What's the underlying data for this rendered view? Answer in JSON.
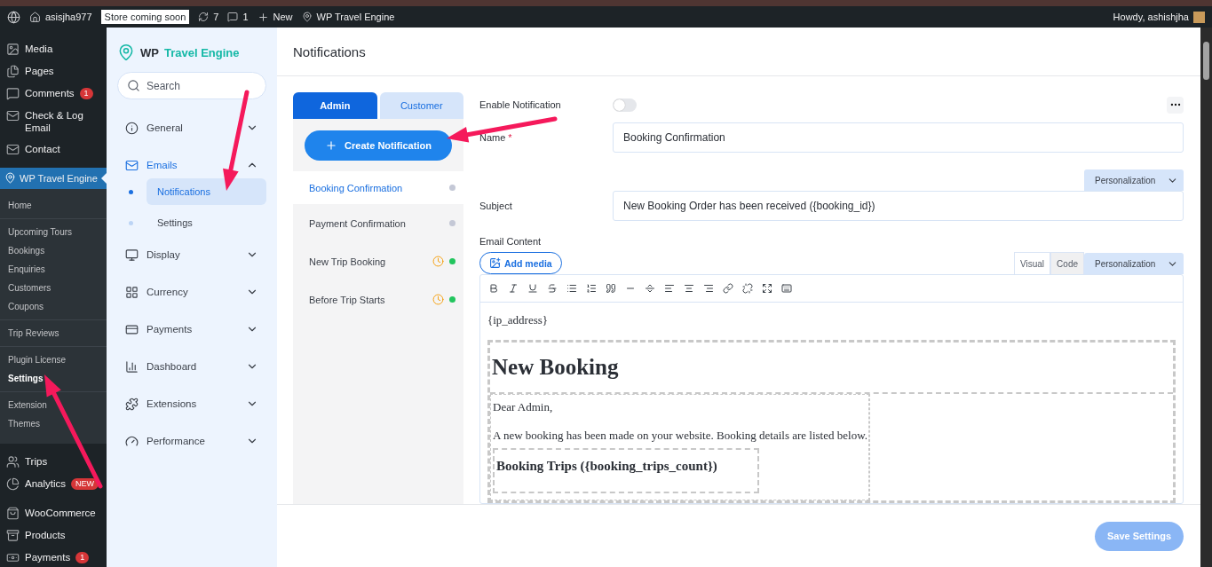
{
  "admin_bar": {
    "site": "asisjha977",
    "store_badge": "Store coming soon",
    "updates": "7",
    "comments": "1",
    "new": "New",
    "plugin": "WP Travel Engine",
    "greeting": "Howdy, ashishjha"
  },
  "wp_menu": {
    "top": [
      {
        "label": "Media"
      },
      {
        "label": "Pages"
      },
      {
        "label": "Comments",
        "badge": "1"
      },
      {
        "label": "Check & Log Email"
      },
      {
        "label": "Contact"
      }
    ],
    "active": {
      "label": "WP Travel Engine"
    },
    "submenu": [
      [
        {
          "label": "Home",
          "selected": false
        }
      ],
      [
        {
          "label": "Upcoming Tours",
          "selected": false
        },
        {
          "label": "Bookings",
          "selected": false
        },
        {
          "label": "Enquiries",
          "selected": false
        },
        {
          "label": "Customers",
          "selected": false
        },
        {
          "label": "Coupons",
          "selected": false
        }
      ],
      [
        {
          "label": "Trip Reviews",
          "selected": false
        }
      ],
      [
        {
          "label": "Plugin License",
          "selected": false
        },
        {
          "label": "Settings",
          "selected": true
        }
      ],
      [
        {
          "label": "Extension",
          "selected": false
        },
        {
          "label": "Themes",
          "selected": false
        }
      ]
    ],
    "bottom": [
      {
        "label": "Trips"
      },
      {
        "label": "Analytics",
        "badge": "NEW"
      },
      {
        "label": "WooCommerce"
      },
      {
        "label": "Products"
      },
      {
        "label": "Payments",
        "badge": "1"
      }
    ]
  },
  "settings_nav": {
    "logo": {
      "prefix": "WP",
      "name": "Travel Engine"
    },
    "search": {
      "placeholder": "Search"
    },
    "items": [
      {
        "label": "General",
        "expanded": false,
        "selected": false
      },
      {
        "label": "Emails",
        "expanded": true,
        "selected": true,
        "children": [
          {
            "label": "Notifications",
            "selected": true
          },
          {
            "label": "Settings",
            "selected": false
          }
        ]
      },
      {
        "label": "Display",
        "expanded": false,
        "selected": false
      },
      {
        "label": "Currency",
        "expanded": false,
        "selected": false
      },
      {
        "label": "Payments",
        "expanded": false,
        "selected": false
      },
      {
        "label": "Dashboard",
        "expanded": false,
        "selected": false
      },
      {
        "label": "Extensions",
        "expanded": false,
        "selected": false
      },
      {
        "label": "Performance",
        "expanded": false,
        "selected": false
      }
    ]
  },
  "page": {
    "title": "Notifications"
  },
  "audience_tabs": [
    {
      "label": "Admin",
      "selected": true
    },
    {
      "label": "Customer",
      "selected": false
    }
  ],
  "create_button": "Create Notification",
  "notifications": [
    {
      "label": "Booking Confirmation",
      "selected": true,
      "scheduled": false,
      "color": "#c4c8d6"
    },
    {
      "label": "Payment Confirmation",
      "selected": false,
      "scheduled": false,
      "color": "#c4c8d6"
    },
    {
      "label": "New Trip Booking",
      "selected": false,
      "scheduled": true,
      "color": "#22c55e"
    },
    {
      "label": "Before Trip Starts",
      "selected": false,
      "scheduled": true,
      "color": "#22c55e"
    }
  ],
  "form": {
    "enable_notification": {
      "label": "Enable Notification",
      "on": false
    },
    "name": {
      "label": "Name",
      "required_mark": "*",
      "value": "Booking Confirmation"
    },
    "subject": {
      "label": "Subject",
      "personalization": "Personalization",
      "value": "New Booking Order has been received ({booking_id})"
    },
    "email_content": {
      "label": "Email Content",
      "add_media": "Add media",
      "tabs": [
        {
          "label": "Visual",
          "selected": true
        },
        {
          "label": "Code",
          "selected": false
        }
      ],
      "personalization": "Personalization",
      "content": {
        "first_line": "{ip_address}",
        "heading": "New Booking",
        "greeting": "Dear Admin,",
        "paragraph": "A new booking has been made on your website. Booking details are listed below.",
        "subheading": "Booking Trips ({booking_trips_count})"
      }
    }
  },
  "footer": {
    "save": {
      "label": "Save Settings",
      "disabled": true
    }
  }
}
